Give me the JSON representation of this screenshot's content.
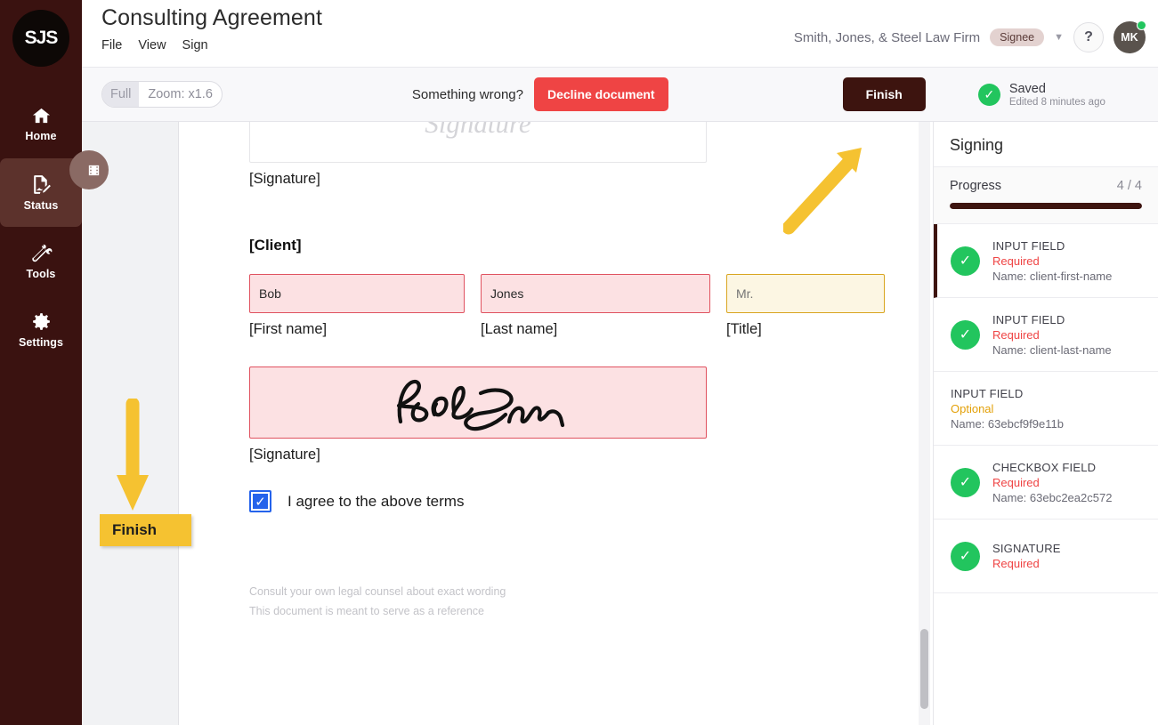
{
  "nav": {
    "logo_text": "SJS",
    "items": [
      {
        "label": "Home",
        "icon": "home-icon"
      },
      {
        "label": "Status",
        "icon": "document-sign-icon"
      },
      {
        "label": "Tools",
        "icon": "tools-icon"
      },
      {
        "label": "Settings",
        "icon": "gear-icon"
      }
    ]
  },
  "header": {
    "title": "Consulting Agreement",
    "menu": [
      "File",
      "View",
      "Sign"
    ],
    "firm": "Smith, Jones, & Steel Law Firm",
    "role_badge": "Signee",
    "help_label": "?",
    "avatar_initials": "MK"
  },
  "toolbar": {
    "zoom_full": "Full",
    "zoom_level": "Zoom: x1.6",
    "something_wrong": "Something wrong?",
    "decline_label": "Decline document",
    "finish_label": "Finish",
    "saved_title": "Saved",
    "saved_subtitle": "Edited 8 minutes ago"
  },
  "document": {
    "signature_placeholder": "Signature",
    "top_signature_label": "[Signature]",
    "client_heading": "[Client]",
    "fields": [
      {
        "value": "Bob",
        "placeholder": "",
        "label": "[First name]",
        "state": "required"
      },
      {
        "value": "Jones",
        "placeholder": "",
        "label": "[Last name]",
        "state": "required"
      },
      {
        "value": "",
        "placeholder": "Mr.",
        "label": "[Title]",
        "state": "optional"
      }
    ],
    "client_signature_label": "[Signature]",
    "agree_label": "I agree to the above terms",
    "agree_checked": true,
    "footnote": [
      "Consult your own legal counsel about exact wording",
      "This document is meant to serve as a reference"
    ]
  },
  "panel": {
    "heading": "Signing",
    "progress_label": "Progress",
    "progress_count": "4 / 4",
    "progress_percent": 100,
    "items": [
      {
        "type": "INPUT FIELD",
        "status": "Required",
        "status_kind": "required",
        "name": "Name: client-first-name",
        "complete": true,
        "active": true
      },
      {
        "type": "INPUT FIELD",
        "status": "Required",
        "status_kind": "required",
        "name": "Name: client-last-name",
        "complete": true,
        "active": false
      },
      {
        "type": "INPUT FIELD",
        "status": "Optional",
        "status_kind": "optional",
        "name": "Name: 63ebcf9f9e11b",
        "complete": false,
        "active": false
      },
      {
        "type": "CHECKBOX FIELD",
        "status": "Required",
        "status_kind": "required",
        "name": "Name: 63ebc2ea2c572",
        "complete": true,
        "active": false
      },
      {
        "type": "SIGNATURE",
        "status": "Required",
        "status_kind": "required",
        "name": "",
        "complete": true,
        "active": false
      }
    ]
  },
  "annotations": {
    "finish_callout": "Finish"
  },
  "colors": {
    "brand_dark": "#3d140f",
    "accent_yellow": "#f5c231",
    "required_red": "#ef4444",
    "optional_amber": "#e3a008",
    "success_green": "#22c55e"
  }
}
